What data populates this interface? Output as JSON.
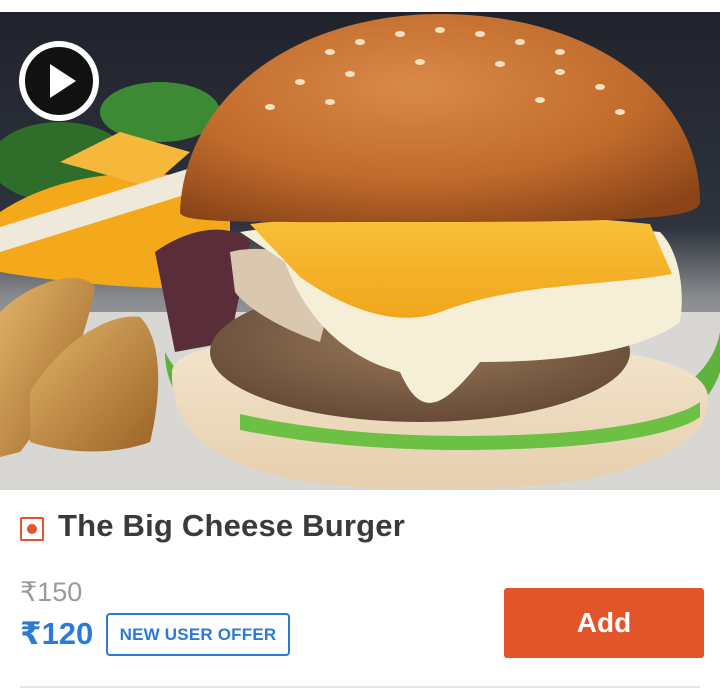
{
  "item": {
    "name": "The Big Cheese Burger",
    "original_price": "₹150",
    "price": "₹120",
    "offer_badge": "NEW USER OFFER",
    "add_label": "Add"
  },
  "icons": {
    "video": "play-icon",
    "food_type": "veg-indicator-icon"
  },
  "colors": {
    "accent": "#e2542a",
    "price_blue": "#2b7bd6",
    "title_text": "#3a3a3a",
    "strike_price": "#9a9a9a"
  }
}
